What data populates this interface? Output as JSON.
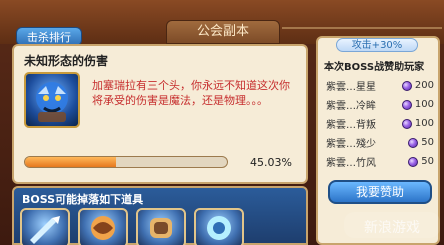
{
  "top": {
    "rank_button": "击杀排行",
    "title": "公会副本"
  },
  "skill": {
    "title": "未知形态的伤害",
    "description": "加塞瑞拉有三个头，你永远不知道这次你将承受的伤害是魔法，还是物理。。。"
  },
  "progress": {
    "value": 45.03,
    "text": "45.03%"
  },
  "drops": {
    "title": "BOSS可能掉落如下道具"
  },
  "right": {
    "bonus": "攻击+30%",
    "title": "本次BOSS战赞助玩家",
    "players": [
      {
        "name": "紫雲…星星",
        "amount": "200"
      },
      {
        "name": "紫雲…冷眸",
        "amount": "100"
      },
      {
        "name": "紫雲…背叛",
        "amount": "100"
      },
      {
        "name": "紫雲…殘少",
        "amount": "50"
      },
      {
        "name": "紫雲…竹风",
        "amount": "50"
      }
    ],
    "sponsor_button": "我要赞助"
  },
  "watermark": {
    "text": "新浪游戏"
  }
}
